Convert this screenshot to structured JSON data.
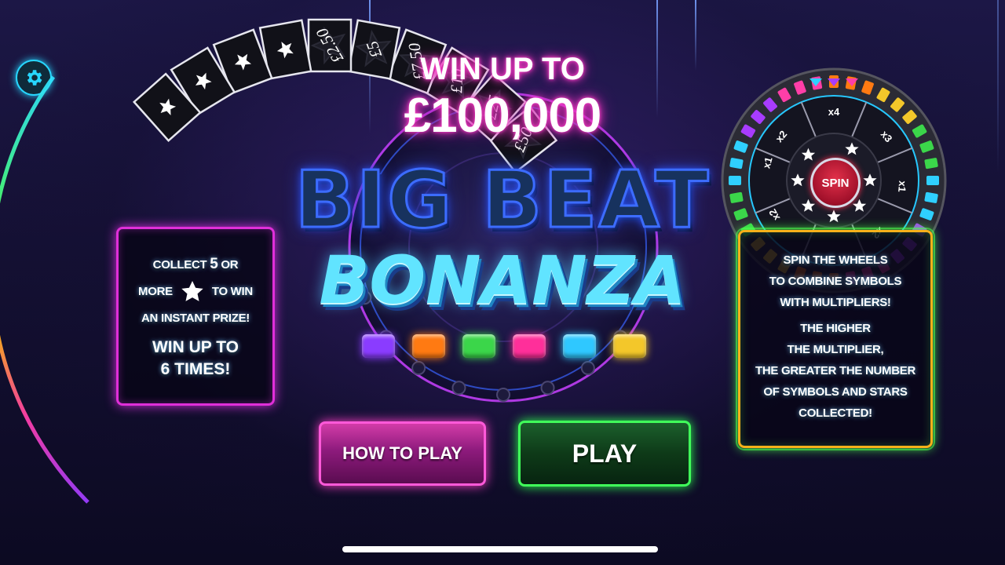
{
  "colors": {
    "pink_neon": "#ff3ec8",
    "green_neon": "#40ff5a",
    "cyan_neon": "#27d6ff",
    "gold": "#f6b11a"
  },
  "settings": {
    "icon": "gear-icon"
  },
  "header": {
    "win_line1": "WIN UP TO",
    "win_line2": "£100,000"
  },
  "logo": {
    "line1": "BIG BEAT",
    "line2": "BONANZA"
  },
  "lights": [
    "#8a3cff",
    "#ff7a12",
    "#3bd64a",
    "#ff2f9a",
    "#2fc8ff",
    "#f3c72a"
  ],
  "prize_ladder": {
    "prizes": [
      "£50",
      "£25",
      "£10",
      "£7.50",
      "£5",
      "£2.50"
    ],
    "star_slots": 4
  },
  "left_panel": {
    "line1_a": "COLLECT ",
    "line1_b": "5",
    "line1_c": " OR",
    "line2_a": "MORE",
    "line2_b": "TO WIN",
    "line3": "AN INSTANT PRIZE!",
    "line4": "WIN UP TO",
    "line5": "6 TIMES!"
  },
  "wheel": {
    "spin_label": "SPIN",
    "multipliers": [
      "x4",
      "x3",
      "x1",
      "x2",
      "x2",
      "x1",
      "x2"
    ]
  },
  "right_panel": {
    "lines": [
      "SPIN THE WHEELS",
      "TO COMBINE SYMBOLS",
      "WITH MULTIPLIERS!",
      "THE HIGHER",
      "THE MULTIPLIER,",
      "THE GREATER THE NUMBER",
      "OF SYMBOLS AND STARS",
      "COLLECTED!"
    ]
  },
  "buttons": {
    "how_to_play": "HOW TO PLAY",
    "play": "PLAY"
  }
}
